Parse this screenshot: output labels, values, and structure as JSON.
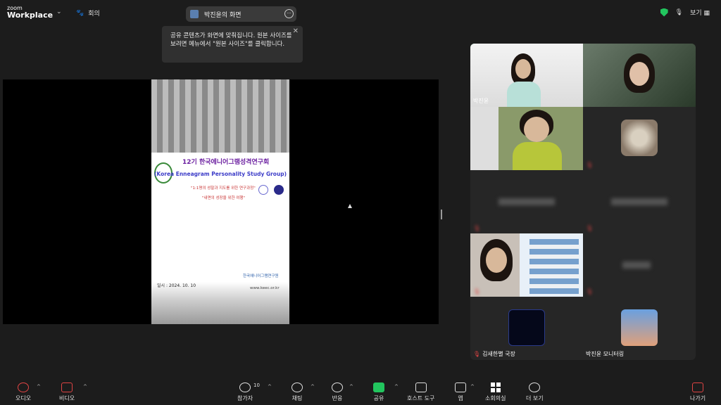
{
  "brand": {
    "line1": "zoom",
    "line2": "Workplace"
  },
  "meeting_label": "회의",
  "share_pill": {
    "label": "박진윤의 화면"
  },
  "top_right": {
    "view_label": "보기"
  },
  "tooltip": {
    "text": "공유 콘텐츠가 화면에 맞춰집니다. 원본 사이즈를 보려면 메뉴에서 \"원본 사이즈\"를 클릭합니다."
  },
  "slide": {
    "title_kr": "12기 한국에니어그램성격연구회",
    "title_en": "(Korea Enneagram Personality Study Group)",
    "sub1": "\"1:1명의 성찰과 지도를 위한 연구과정\"",
    "sub2": "\"내면의 성장을 위한 여행\"",
    "date": "일시 : 2024. 10. 10",
    "org": "한국에니어그램연구원",
    "web": "www.keec.or.kr"
  },
  "gallery": {
    "tiles": [
      {
        "name": "박진윤"
      },
      {
        "name": ""
      },
      {
        "name": ""
      },
      {
        "name": ""
      },
      {
        "name": ""
      },
      {
        "name": ""
      },
      {
        "name": ""
      },
      {
        "name": ""
      },
      {
        "name": "김새한별 국장"
      },
      {
        "name": "박진윤 모니터링"
      }
    ]
  },
  "toolbar": {
    "audio": "오디오",
    "video": "비디오",
    "participants": "참가자",
    "participants_count": "10",
    "chat": "채팅",
    "react": "반응",
    "share": "공유",
    "host_tools": "호스트 도구",
    "apps": "앱",
    "rooms": "소회의실",
    "more": "더 보기",
    "leave": "나가기"
  },
  "colors": {
    "accent_green": "#22c55e",
    "mute_red": "#e04444",
    "active_outline": "#4ade80"
  }
}
